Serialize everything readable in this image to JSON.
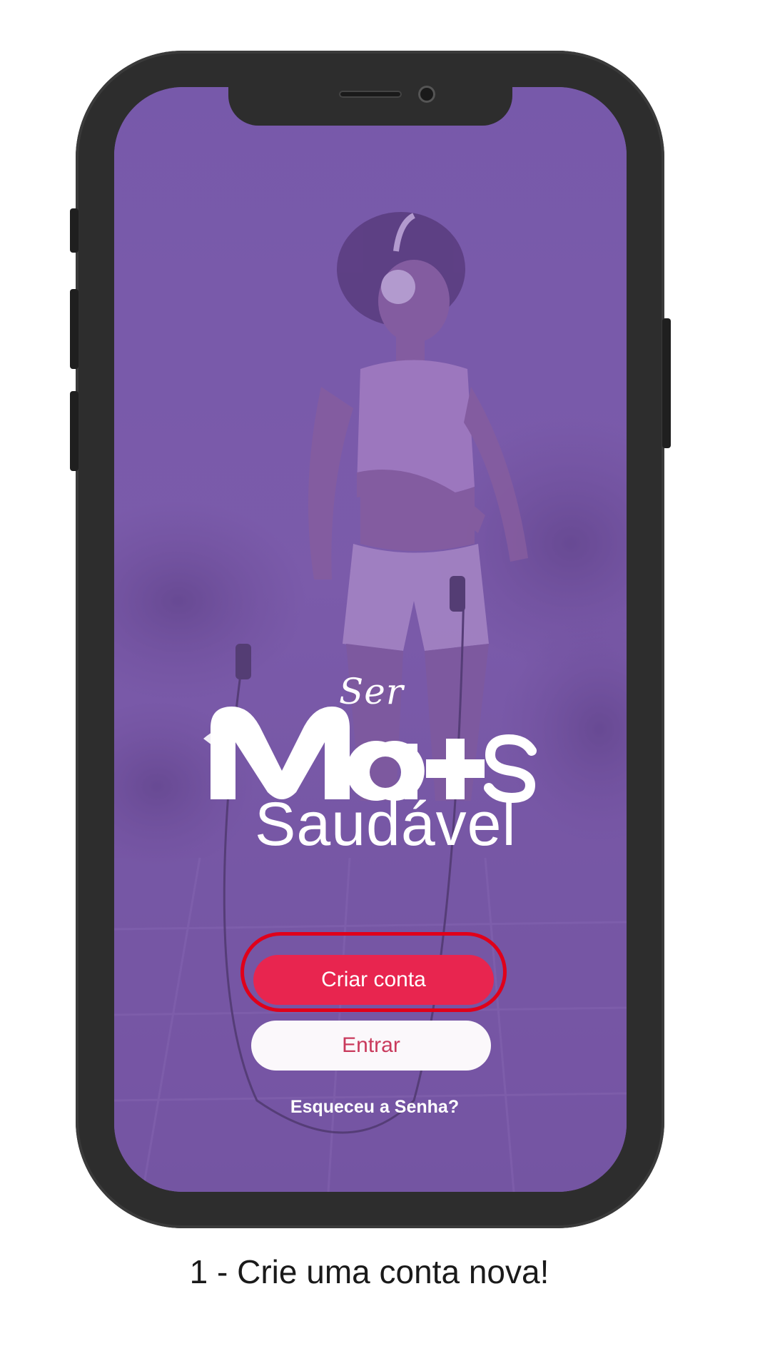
{
  "app": {
    "logo": {
      "ser": "Ser",
      "mais": "Ma+s",
      "saudavel": "Saudável"
    },
    "buttons": {
      "create_account": "Criar conta",
      "login": "Entrar"
    },
    "forgot_password": "Esqueceu a Senha?"
  },
  "caption": "1 - Crie uma conta nova!",
  "colors": {
    "overlay_purple": "#7a5aa8",
    "primary_button": "#e8254f",
    "secondary_button": "#fbf8fb",
    "secondary_text": "#c93a5c",
    "highlight": "#e0001a",
    "phone_frame": "#2d2d2d"
  }
}
